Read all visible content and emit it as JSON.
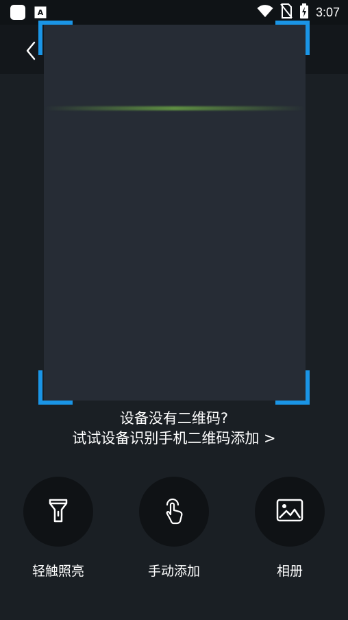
{
  "status_bar": {
    "time": "3:07",
    "left_icons": [
      "app-square-icon",
      "text-a-icon"
    ],
    "right_icons": [
      "wifi-icon",
      "no-sim-icon",
      "battery-charging-icon"
    ]
  },
  "toolbar": {
    "back_icon": "chevron-left-icon"
  },
  "scanner": {
    "frame_color": "#262c35",
    "corner_color": "#1a95e6",
    "scan_line_color": "#6aa844"
  },
  "hint": {
    "line1": "设备没有二维码?",
    "line2": "试试设备识别手机二维码添加 >"
  },
  "actions": [
    {
      "label": "轻触照亮",
      "icon": "flashlight-icon"
    },
    {
      "label": "手动添加",
      "icon": "tap-hand-icon"
    },
    {
      "label": "相册",
      "icon": "image-icon"
    }
  ]
}
